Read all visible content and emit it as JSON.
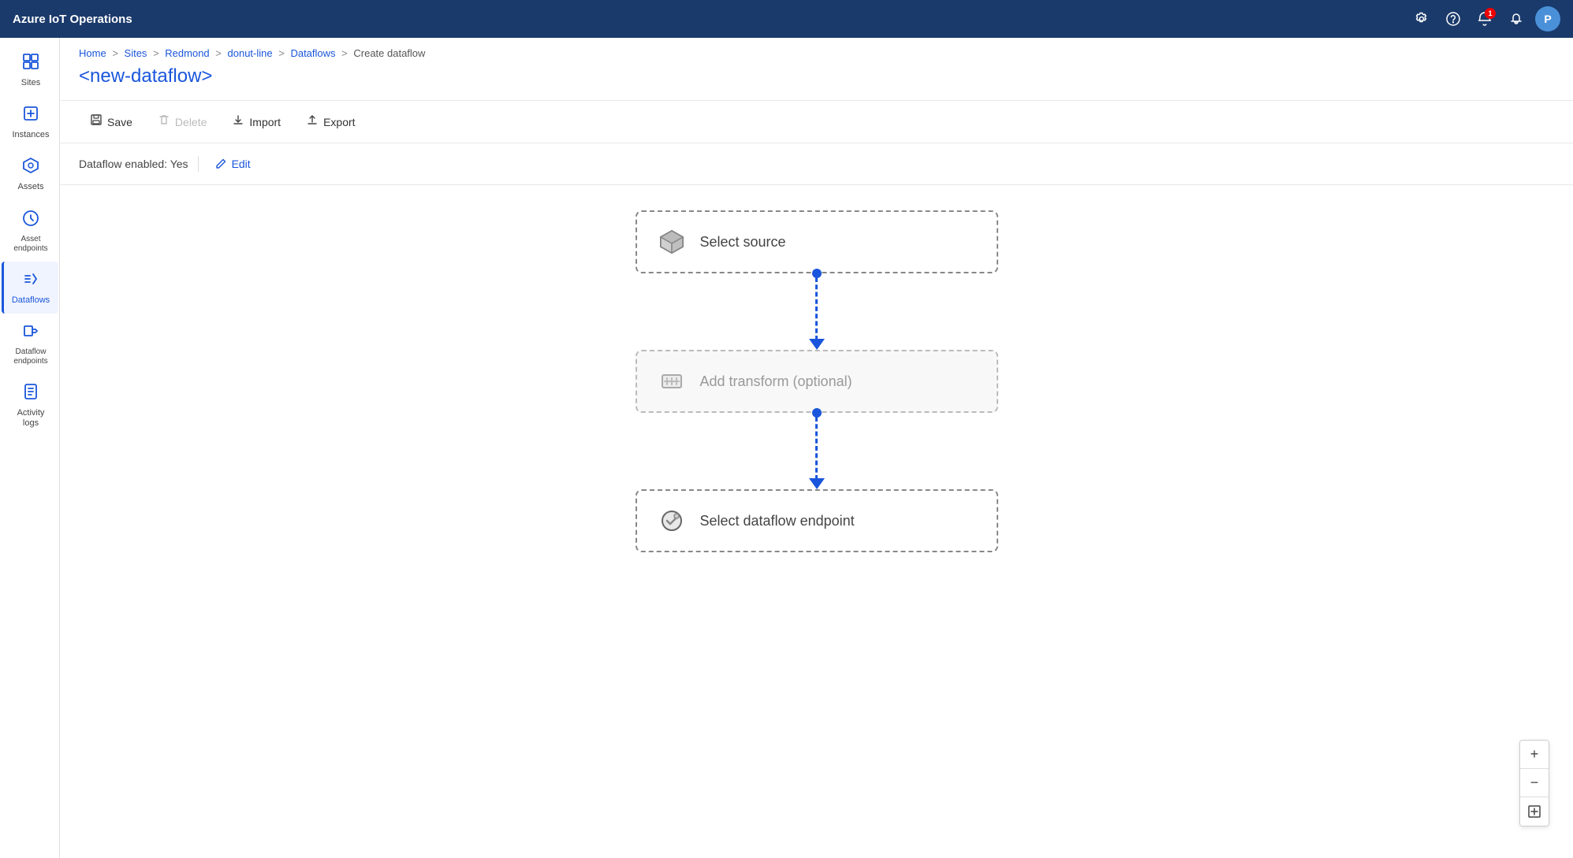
{
  "app": {
    "title": "Azure IoT Operations"
  },
  "topbar": {
    "title": "Azure IoT Operations",
    "avatar_label": "P",
    "notification_count": "1"
  },
  "sidebar": {
    "items": [
      {
        "id": "sites",
        "label": "Sites",
        "icon": "⊞",
        "active": false
      },
      {
        "id": "instances",
        "label": "Instances",
        "icon": "❑",
        "active": false
      },
      {
        "id": "assets",
        "label": "Assets",
        "icon": "◈",
        "active": false
      },
      {
        "id": "asset-endpoints",
        "label": "Asset endpoints",
        "icon": "⬡",
        "active": false
      },
      {
        "id": "dataflows",
        "label": "Dataflows",
        "icon": "⇌",
        "active": true
      },
      {
        "id": "dataflow-endpoints",
        "label": "Dataflow endpoints",
        "icon": "⇲",
        "active": false
      },
      {
        "id": "activity-logs",
        "label": "Activity logs",
        "icon": "☰",
        "active": false
      }
    ]
  },
  "breadcrumb": {
    "parts": [
      "Home",
      "Sites",
      "Redmond",
      "donut-line",
      "Dataflows",
      "Create dataflow"
    ]
  },
  "page": {
    "title": "<new-dataflow>"
  },
  "toolbar": {
    "save_label": "Save",
    "delete_label": "Delete",
    "import_label": "Import",
    "export_label": "Export"
  },
  "status": {
    "label": "Dataflow enabled: Yes",
    "edit_label": "Edit"
  },
  "flow": {
    "source_label": "Select source",
    "transform_label": "Add transform (optional)",
    "endpoint_label": "Select dataflow endpoint"
  },
  "zoom": {
    "plus_label": "+",
    "minus_label": "−"
  }
}
